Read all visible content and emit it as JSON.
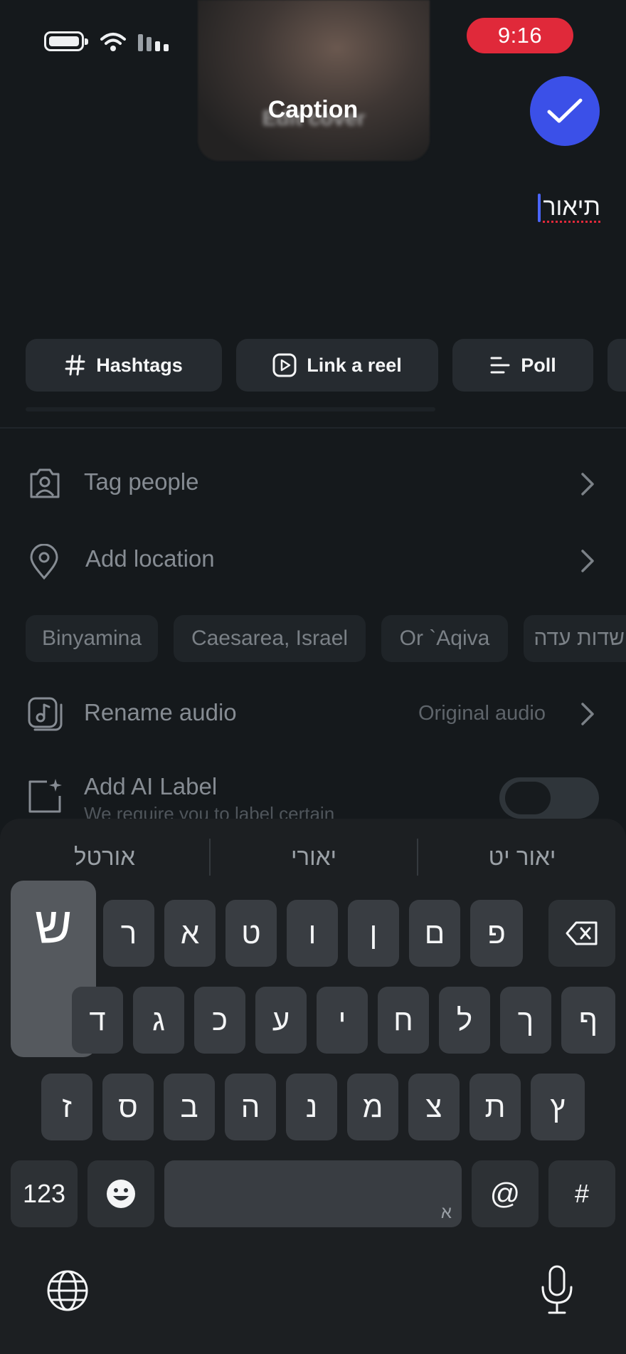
{
  "status_bar": {
    "time": "9:16",
    "time_pill_color": "#e0293a"
  },
  "header": {
    "cover_label": "Edit cover",
    "title": "Caption",
    "done_icon": "check-icon",
    "accent": "#3b50e8"
  },
  "caption": {
    "text": "תיאור"
  },
  "chips": [
    {
      "label": "Hashtags",
      "icon": "hashtag-icon"
    },
    {
      "label": "Link a reel",
      "icon": "play-square-icon"
    },
    {
      "label": "Poll",
      "icon": "poll-icon"
    }
  ],
  "settings": {
    "tag_people": "Tag people",
    "add_location": "Add location",
    "location_suggestions": [
      "Binyamina",
      "Caesarea, Israel",
      "Or `Aqiva",
      "שדות עדה"
    ],
    "rename_audio": "Rename audio",
    "audio_value": "Original audio",
    "ai_label_title": "Add AI Label",
    "ai_label_desc": "We require you to label certain"
  },
  "keyboard": {
    "suggestions": [
      "יאור יט",
      "יאורי",
      "אורטל"
    ],
    "preview_key": "ש",
    "row1": [
      "פ",
      "ם",
      "ן",
      "ו",
      "ט",
      "א",
      "ר"
    ],
    "row2": [
      "ף",
      "ך",
      "ל",
      "ח",
      "י",
      "ע",
      "כ",
      "ג",
      "ד"
    ],
    "row3": [
      "ץ",
      "ת",
      "צ",
      "מ",
      "נ",
      "ה",
      "ב",
      "ס",
      "ז"
    ],
    "numbers_key": "123",
    "space_hint": "א",
    "at_key": "@",
    "hash_key": "#"
  }
}
